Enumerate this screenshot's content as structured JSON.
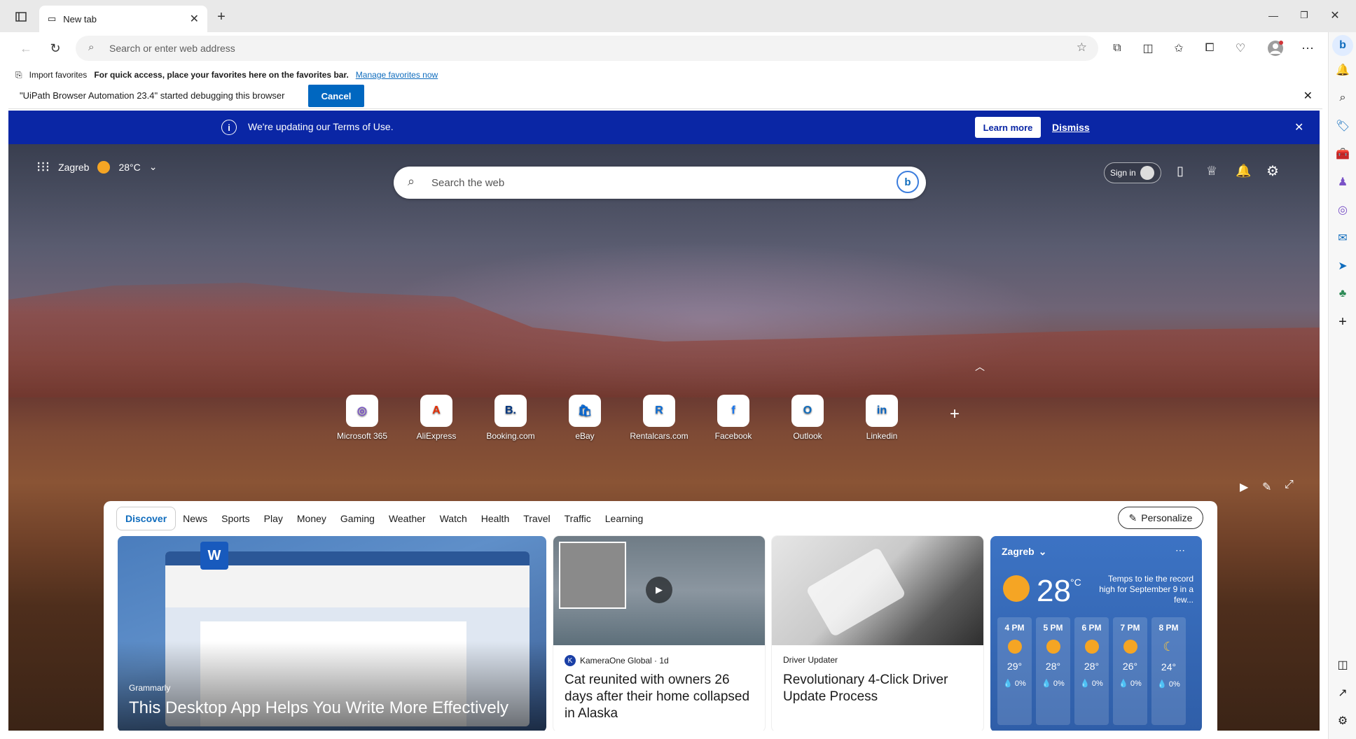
{
  "browser": {
    "tab_title": "New tab",
    "address_placeholder": "Search or enter web address",
    "favorites": {
      "import_label": "Import favorites",
      "hint": "For quick access, place your favorites here on the favorites bar.",
      "manage_link": "Manage favorites now"
    },
    "debug_bar": {
      "message": "\"UiPath Browser Automation 23.4\" started debugging this browser",
      "cancel_label": "Cancel"
    }
  },
  "terms_banner": {
    "message": "We're updating our Terms of Use.",
    "learn_more": "Learn more",
    "dismiss": "Dismiss"
  },
  "header": {
    "location": "Zagreb",
    "temperature": "28°C",
    "search_placeholder": "Search the web",
    "sign_in": "Sign in"
  },
  "quick_links": [
    {
      "label": "Microsoft 365",
      "glyph": "◎",
      "color": "#7a52c7"
    },
    {
      "label": "AliExpress",
      "glyph": "A",
      "color": "#e62e04"
    },
    {
      "label": "Booking.com",
      "glyph": "B.",
      "color": "#003580"
    },
    {
      "label": "eBay",
      "glyph": "🛍",
      "color": "#0064d2"
    },
    {
      "label": "Rentalcars.com",
      "glyph": "R",
      "color": "#0a6cd6"
    },
    {
      "label": "Facebook",
      "glyph": "f",
      "color": "#1877f2"
    },
    {
      "label": "Outlook",
      "glyph": "O",
      "color": "#0f6cbd"
    },
    {
      "label": "Linkedin",
      "glyph": "in",
      "color": "#0a66c2"
    }
  ],
  "feed": {
    "tabs": [
      "Discover",
      "News",
      "Sports",
      "Play",
      "Money",
      "Gaming",
      "Weather",
      "Watch",
      "Health",
      "Travel",
      "Traffic",
      "Learning"
    ],
    "personalize": "Personalize",
    "cards": [
      {
        "source": "Grammarly",
        "title": "This Desktop App Helps You Write More Effectively"
      },
      {
        "source": "KameraOne Global · 1d",
        "title": "Cat reunited with owners 26 days after their home collapsed in Alaska"
      },
      {
        "source": "Driver Updater",
        "title": "Revolutionary 4-Click Driver Update Process"
      }
    ],
    "weather": {
      "city": "Zagreb",
      "temp": "28",
      "unit": "°C",
      "note": "Temps to tie the record high for September 9 in a few...",
      "hours": [
        {
          "time": "4 PM",
          "temp": "29°",
          "precip": "0%"
        },
        {
          "time": "5 PM",
          "temp": "28°",
          "precip": "0%"
        },
        {
          "time": "6 PM",
          "temp": "28°",
          "precip": "0%"
        },
        {
          "time": "7 PM",
          "temp": "26°",
          "precip": "0%"
        },
        {
          "time": "8 PM",
          "temp": "24°",
          "precip": "0%"
        }
      ]
    }
  }
}
